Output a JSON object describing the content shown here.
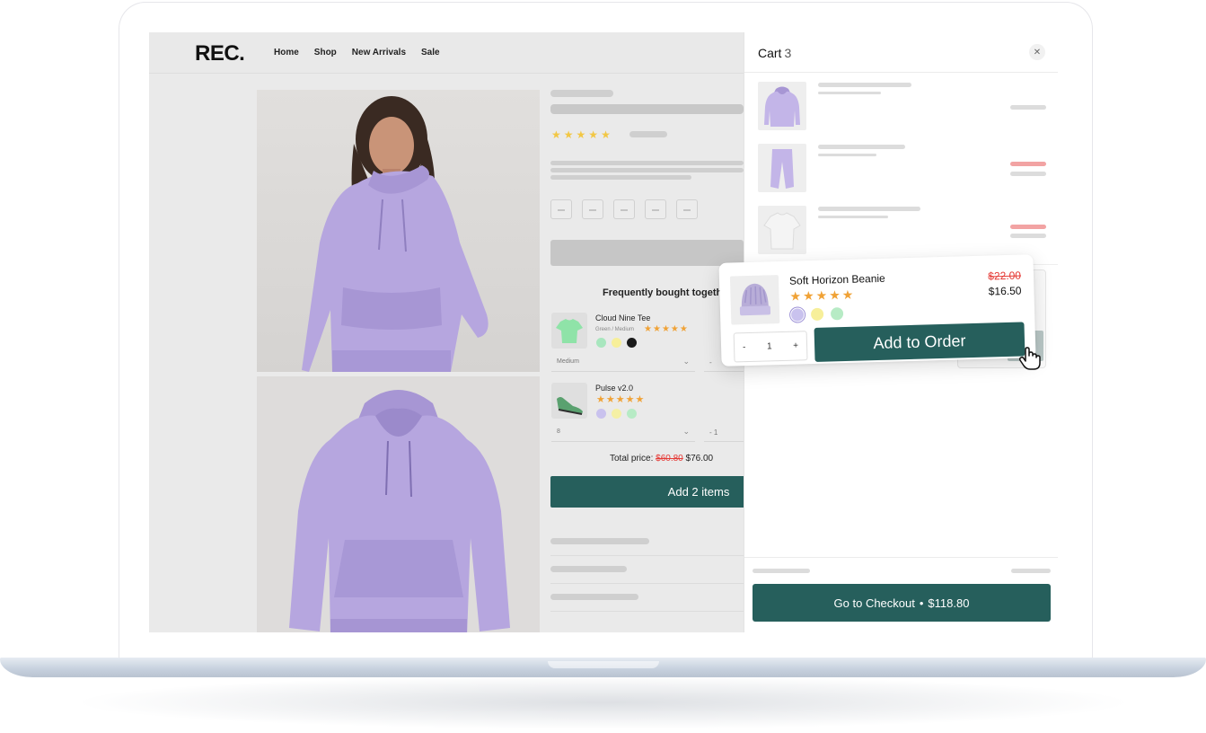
{
  "store": {
    "logo": "REC.",
    "nav": [
      "Home",
      "Shop",
      "New Arrivals",
      "Sale"
    ]
  },
  "product": {
    "rating_stars": 5
  },
  "frequently_bought": {
    "title": "Frequently bought together",
    "items": [
      {
        "name": "Cloud Nine Tee",
        "variant": "Green / Medium",
        "rating_stars": 5,
        "swatches": [
          "#a8e6be",
          "#f7ef9a",
          "#1a1a1a"
        ],
        "select_value": "Medium",
        "qty": "-"
      },
      {
        "name": "Pulse v2.0",
        "rating_stars": 5,
        "swatches": [
          "#c9c2ee",
          "#f5f0a5",
          "#b7ebc5"
        ],
        "select_value": "8",
        "qty": "-  1"
      }
    ],
    "total_label": "Total price:",
    "total_old": "$60.80",
    "total_new": "$76.00",
    "add_button": "Add 2 items"
  },
  "cart": {
    "title": "Cart",
    "count": "3",
    "close_icon": "close-icon",
    "checkout_label": "Go to Checkout",
    "checkout_separator": "•",
    "checkout_total": "$118.80"
  },
  "upsell": {
    "name": "Soft Horizon Beanie",
    "old_price": "$22.00",
    "new_price": "$16.50",
    "rating_stars": 5,
    "swatches": [
      "#c9c2ee",
      "#f7ef9a",
      "#b7ebc5"
    ],
    "qty_minus": "-",
    "qty_value": "1",
    "qty_plus": "+",
    "add_button": "Add to Order"
  },
  "colors": {
    "accent": "#265f5c",
    "sale": "#e53935",
    "star": "#f0a236",
    "product_purple": "#b6a6df"
  }
}
